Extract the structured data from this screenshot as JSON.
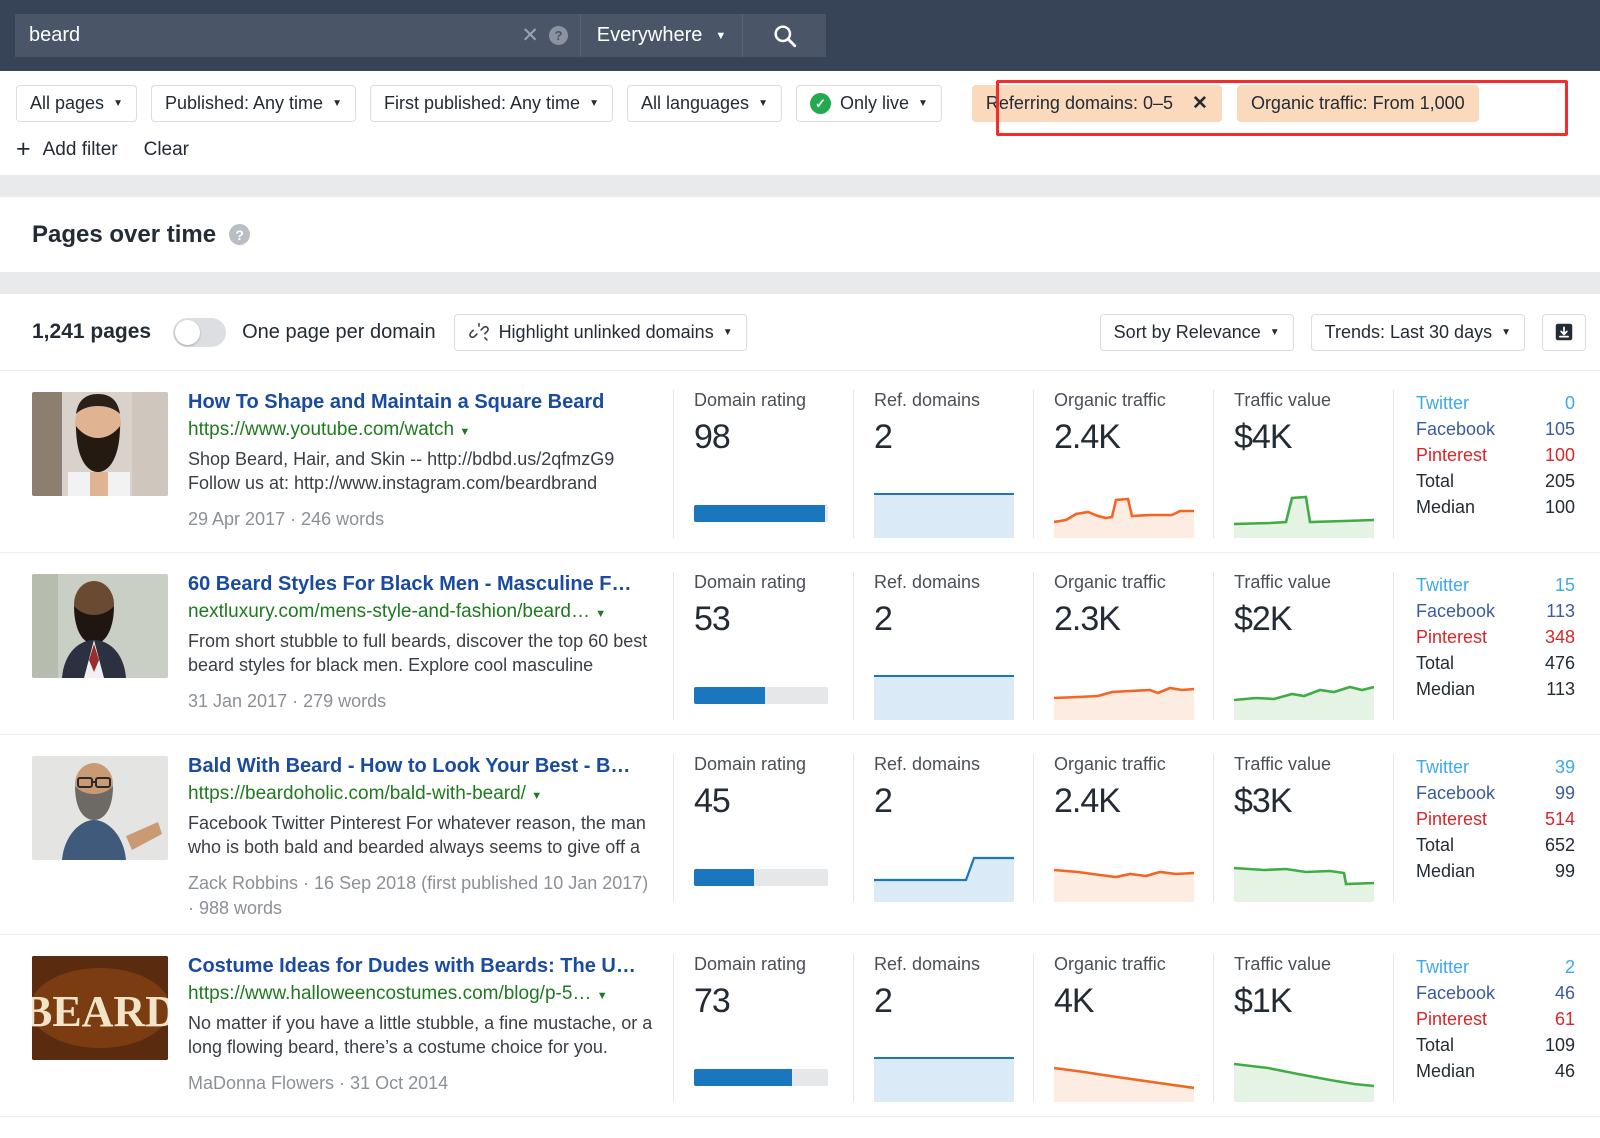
{
  "search": {
    "query": "beard",
    "clear_icon": "close-x-icon",
    "help_icon": "question-mark-icon",
    "scope": "Everywhere",
    "search_icon": "magnifier-icon"
  },
  "filters": {
    "chips": [
      {
        "label": "All pages",
        "caret": "▼"
      },
      {
        "label": "Published: Any time",
        "caret": "▼"
      },
      {
        "label": "First published: Any time",
        "caret": "▼"
      },
      {
        "label": "All languages",
        "caret": "▼"
      },
      {
        "label": "Only live",
        "caret": "▼",
        "icon": "green-check-icon"
      }
    ],
    "active_chips": [
      {
        "label": "Referring domains: 0–5",
        "remove": "✕"
      },
      {
        "label": "Organic traffic: From 1,000"
      }
    ],
    "add_filter": "Add filter",
    "add_filter_icon": "plus-icon",
    "clear": "Clear",
    "highlight_color": "#f42c2c",
    "active_chip_color": "#fad9bd"
  },
  "pages_over_time": {
    "title": "Pages over time",
    "help_icon": "question-mark-icon"
  },
  "toolbar": {
    "page_count": "1,241 pages",
    "toggle_label": "One page per domain",
    "toggle_on": false,
    "highlight_unlinked": "Highlight unlinked domains",
    "highlight_icon": "broken-link-icon",
    "sort": "Sort by Relevance",
    "trends": "Trends: Last 30 days",
    "export_icon": "download-icon",
    "caret": "▼"
  },
  "columns": {
    "domain_rating": "Domain rating",
    "ref_domains": "Ref. domains",
    "organic_traffic": "Organic traffic",
    "traffic_value": "Traffic value"
  },
  "social_labels": {
    "twitter": "Twitter",
    "facebook": "Facebook",
    "pinterest": "Pinterest",
    "total": "Total",
    "median": "Median"
  },
  "colors": {
    "traffic_line": "#f26522",
    "value_line": "#41ab45",
    "bar_fill": "#1a77bd",
    "refdomains_line": "#1a77bd",
    "title_link": "#1a4ba0",
    "url_link": "#1f7a1f"
  },
  "results": [
    {
      "thumb": "bearded-man-photo",
      "title": "How To Shape and Maintain a Square Beard",
      "url": "https://www.youtube.com/watch",
      "desc": "Shop Beard, Hair, and Skin -- http://bdbd.us/2qfmzG9 Follow us at: http://www.instagram.com/beardbrand",
      "meta": "29 Apr 2017 · 246 words",
      "domain_rating": "98",
      "dr_pct": 98,
      "ref_domains": "2",
      "organic_traffic": "2.4K",
      "traffic_value": "$4K",
      "social": {
        "twitter": "0",
        "facebook": "105",
        "pinterest": "100",
        "total": "205",
        "median": "100"
      }
    },
    {
      "thumb": "man-in-suit-photo",
      "title": "60 Beard Styles For Black Men - Masculine F…",
      "url": "nextluxury.com/mens-style-and-fashion/beard…",
      "desc": "From short stubble to full beards, discover the top 60 best beard styles for black men. Explore cool masculine",
      "meta": "31 Jan 2017 · 279 words",
      "domain_rating": "53",
      "dr_pct": 53,
      "ref_domains": "2",
      "organic_traffic": "2.3K",
      "traffic_value": "$2K",
      "social": {
        "twitter": "15",
        "facebook": "113",
        "pinterest": "348",
        "total": "476",
        "median": "113"
      }
    },
    {
      "thumb": "bald-bearded-man-photo",
      "title": "Bald With Beard - How to Look Your Best - B…",
      "url": "https://beardoholic.com/bald-with-beard/",
      "desc": "Facebook Twitter Pinterest For whatever reason, the man who is both bald and bearded always seems to give off a",
      "meta": "Zack Robbins · 16 Sep 2018 (first published 10 Jan 2017) · 988 words",
      "domain_rating": "45",
      "dr_pct": 45,
      "ref_domains": "2",
      "organic_traffic": "2.4K",
      "traffic_value": "$3K",
      "social": {
        "twitter": "39",
        "facebook": "99",
        "pinterest": "514",
        "total": "652",
        "median": "99"
      }
    },
    {
      "thumb": "beard-logo-graphic",
      "title": "Costume Ideas for Dudes with Beards: The U…",
      "url": "https://www.halloweencostumes.com/blog/p-5…",
      "desc": "No matter if you have a little stubble, a fine mustache, or a long flowing beard, there’s a costume choice for you.",
      "meta": "MaDonna Flowers · 31 Oct 2014",
      "domain_rating": "73",
      "dr_pct": 73,
      "ref_domains": "2",
      "organic_traffic": "4K",
      "traffic_value": "$1K",
      "social": {
        "twitter": "2",
        "facebook": "46",
        "pinterest": "61",
        "total": "109",
        "median": "46"
      }
    }
  ]
}
